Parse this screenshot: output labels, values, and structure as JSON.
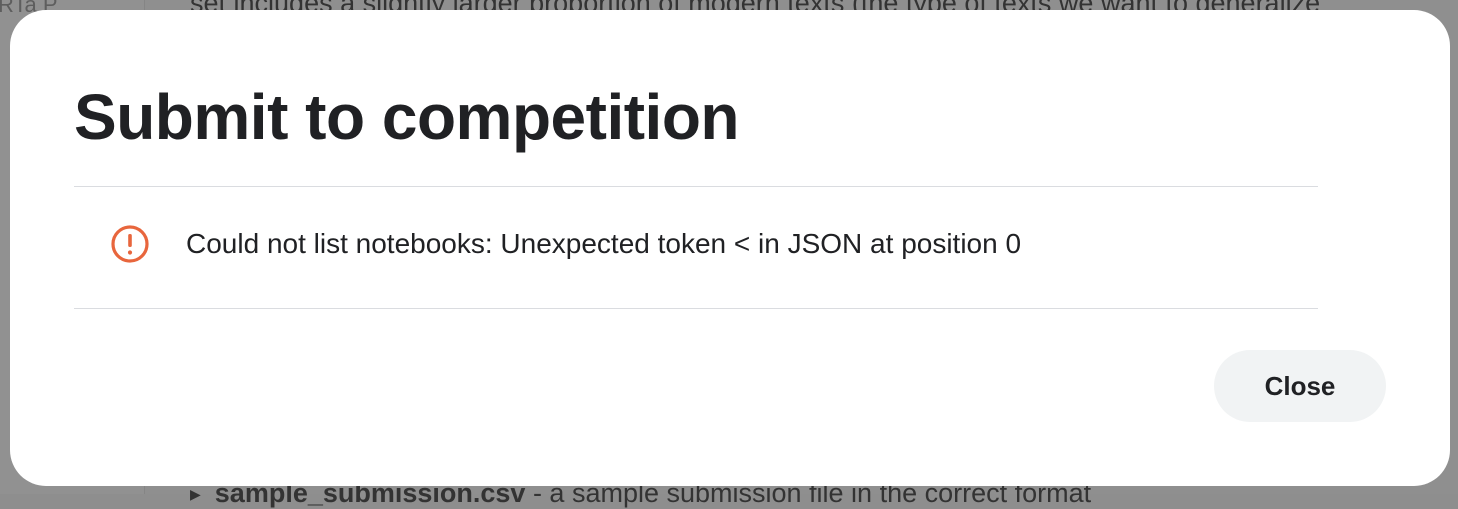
{
  "background": {
    "sidebar_text": "RTa P",
    "top_text": "set includes a slightly larger proportion of modern texts (the type of texts we want to generalize",
    "bottom_file": "sample_submission.csv",
    "bottom_description": " - a sample submission file in the correct format"
  },
  "modal": {
    "title": "Submit to competition",
    "error": {
      "icon": "alert-circle-icon",
      "icon_color": "#e8663d",
      "message": "Could not list notebooks: Unexpected token < in JSON at position 0"
    },
    "close_label": "Close"
  }
}
